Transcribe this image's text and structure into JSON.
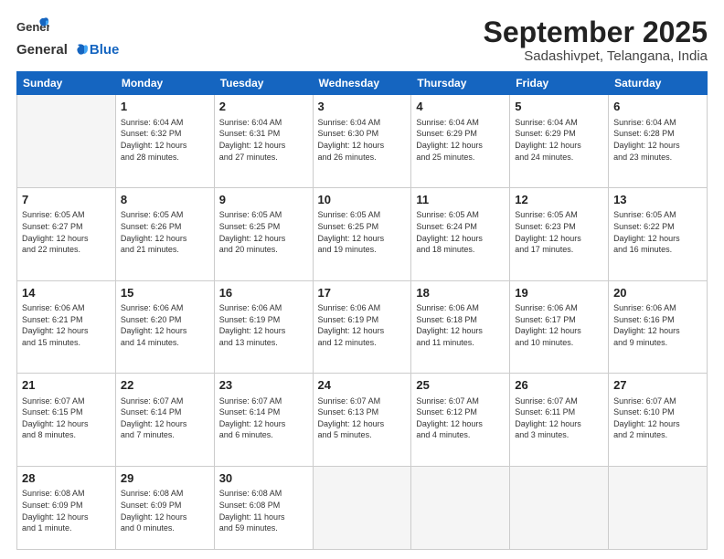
{
  "logo": {
    "general": "General",
    "blue": "Blue"
  },
  "header": {
    "month": "September 2025",
    "location": "Sadashivpet, Telangana, India"
  },
  "weekdays": [
    "Sunday",
    "Monday",
    "Tuesday",
    "Wednesday",
    "Thursday",
    "Friday",
    "Saturday"
  ],
  "weeks": [
    [
      {
        "day": "",
        "info": ""
      },
      {
        "day": "1",
        "info": "Sunrise: 6:04 AM\nSunset: 6:32 PM\nDaylight: 12 hours\nand 28 minutes."
      },
      {
        "day": "2",
        "info": "Sunrise: 6:04 AM\nSunset: 6:31 PM\nDaylight: 12 hours\nand 27 minutes."
      },
      {
        "day": "3",
        "info": "Sunrise: 6:04 AM\nSunset: 6:30 PM\nDaylight: 12 hours\nand 26 minutes."
      },
      {
        "day": "4",
        "info": "Sunrise: 6:04 AM\nSunset: 6:29 PM\nDaylight: 12 hours\nand 25 minutes."
      },
      {
        "day": "5",
        "info": "Sunrise: 6:04 AM\nSunset: 6:29 PM\nDaylight: 12 hours\nand 24 minutes."
      },
      {
        "day": "6",
        "info": "Sunrise: 6:04 AM\nSunset: 6:28 PM\nDaylight: 12 hours\nand 23 minutes."
      }
    ],
    [
      {
        "day": "7",
        "info": "Sunrise: 6:05 AM\nSunset: 6:27 PM\nDaylight: 12 hours\nand 22 minutes."
      },
      {
        "day": "8",
        "info": "Sunrise: 6:05 AM\nSunset: 6:26 PM\nDaylight: 12 hours\nand 21 minutes."
      },
      {
        "day": "9",
        "info": "Sunrise: 6:05 AM\nSunset: 6:25 PM\nDaylight: 12 hours\nand 20 minutes."
      },
      {
        "day": "10",
        "info": "Sunrise: 6:05 AM\nSunset: 6:25 PM\nDaylight: 12 hours\nand 19 minutes."
      },
      {
        "day": "11",
        "info": "Sunrise: 6:05 AM\nSunset: 6:24 PM\nDaylight: 12 hours\nand 18 minutes."
      },
      {
        "day": "12",
        "info": "Sunrise: 6:05 AM\nSunset: 6:23 PM\nDaylight: 12 hours\nand 17 minutes."
      },
      {
        "day": "13",
        "info": "Sunrise: 6:05 AM\nSunset: 6:22 PM\nDaylight: 12 hours\nand 16 minutes."
      }
    ],
    [
      {
        "day": "14",
        "info": "Sunrise: 6:06 AM\nSunset: 6:21 PM\nDaylight: 12 hours\nand 15 minutes."
      },
      {
        "day": "15",
        "info": "Sunrise: 6:06 AM\nSunset: 6:20 PM\nDaylight: 12 hours\nand 14 minutes."
      },
      {
        "day": "16",
        "info": "Sunrise: 6:06 AM\nSunset: 6:19 PM\nDaylight: 12 hours\nand 13 minutes."
      },
      {
        "day": "17",
        "info": "Sunrise: 6:06 AM\nSunset: 6:19 PM\nDaylight: 12 hours\nand 12 minutes."
      },
      {
        "day": "18",
        "info": "Sunrise: 6:06 AM\nSunset: 6:18 PM\nDaylight: 12 hours\nand 11 minutes."
      },
      {
        "day": "19",
        "info": "Sunrise: 6:06 AM\nSunset: 6:17 PM\nDaylight: 12 hours\nand 10 minutes."
      },
      {
        "day": "20",
        "info": "Sunrise: 6:06 AM\nSunset: 6:16 PM\nDaylight: 12 hours\nand 9 minutes."
      }
    ],
    [
      {
        "day": "21",
        "info": "Sunrise: 6:07 AM\nSunset: 6:15 PM\nDaylight: 12 hours\nand 8 minutes."
      },
      {
        "day": "22",
        "info": "Sunrise: 6:07 AM\nSunset: 6:14 PM\nDaylight: 12 hours\nand 7 minutes."
      },
      {
        "day": "23",
        "info": "Sunrise: 6:07 AM\nSunset: 6:14 PM\nDaylight: 12 hours\nand 6 minutes."
      },
      {
        "day": "24",
        "info": "Sunrise: 6:07 AM\nSunset: 6:13 PM\nDaylight: 12 hours\nand 5 minutes."
      },
      {
        "day": "25",
        "info": "Sunrise: 6:07 AM\nSunset: 6:12 PM\nDaylight: 12 hours\nand 4 minutes."
      },
      {
        "day": "26",
        "info": "Sunrise: 6:07 AM\nSunset: 6:11 PM\nDaylight: 12 hours\nand 3 minutes."
      },
      {
        "day": "27",
        "info": "Sunrise: 6:07 AM\nSunset: 6:10 PM\nDaylight: 12 hours\nand 2 minutes."
      }
    ],
    [
      {
        "day": "28",
        "info": "Sunrise: 6:08 AM\nSunset: 6:09 PM\nDaylight: 12 hours\nand 1 minute."
      },
      {
        "day": "29",
        "info": "Sunrise: 6:08 AM\nSunset: 6:09 PM\nDaylight: 12 hours\nand 0 minutes."
      },
      {
        "day": "30",
        "info": "Sunrise: 6:08 AM\nSunset: 6:08 PM\nDaylight: 11 hours\nand 59 minutes."
      },
      {
        "day": "",
        "info": ""
      },
      {
        "day": "",
        "info": ""
      },
      {
        "day": "",
        "info": ""
      },
      {
        "day": "",
        "info": ""
      }
    ]
  ]
}
